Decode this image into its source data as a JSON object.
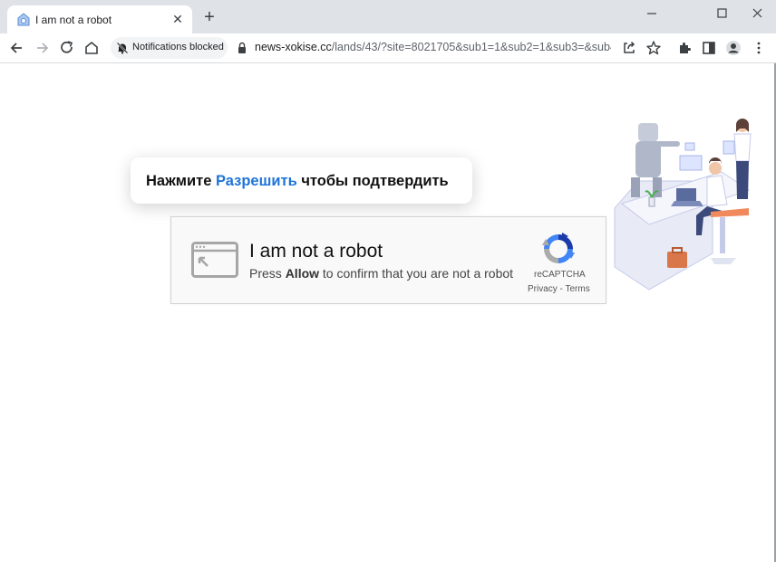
{
  "browser": {
    "tab": {
      "title": "I am not a robot",
      "close_glyph": "✕"
    },
    "new_tab_glyph": "+",
    "notifications_chip": "Notifications blocked",
    "url": {
      "domain": "news-xokise.cc",
      "path": "/lands/43/?site=8021705&sub1=1&sub2=1&sub3=&sub4="
    }
  },
  "page": {
    "bubble": {
      "before": "Нажмите ",
      "highlight": "Разрешить",
      "after": " чтобы подтвердить"
    },
    "captcha": {
      "title": "I am not a robot",
      "sub_before": "Press ",
      "sub_bold": "Allow",
      "sub_after": " to confirm that you are not a robot",
      "brand": "reCAPTCHA",
      "links": "Privacy - Terms"
    }
  },
  "colors": {
    "accent": "#1e74d8",
    "tabstrip": "#dfe3e8",
    "captcha_bg": "#f9f9f9"
  }
}
